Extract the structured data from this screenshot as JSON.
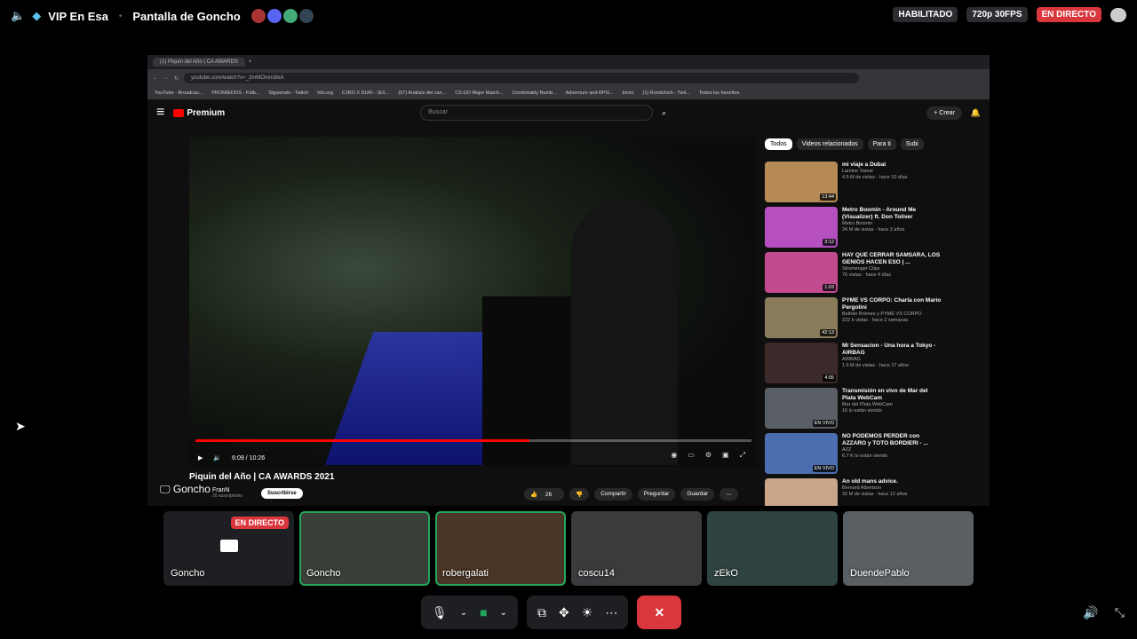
{
  "topbar": {
    "server_name": "VIP En Esa",
    "stream_title": "Pantalla de Goncho",
    "status_habilitado": "HABILITADO",
    "quality": "720p 30FPS",
    "live_label": "EN DIRECTO",
    "colors": {
      "live": "#da373c",
      "speaking": "#23a55a"
    }
  },
  "browser": {
    "tab_title": "(1) Piquín del Año | CA AWARDS",
    "url": "youtube.com/watch?v=_2mMOmm3lxA",
    "bookmarks": [
      "YouTube - Broadcas...",
      "PROMIEDOS - Fútb...",
      "Siguiendo - Twitch",
      "hltv.org",
      "CJRO X DUKI - (EX...",
      "(57) Análisis del can...",
      "CS:GO Major Match...",
      "Comfortably Numb...",
      "Adventure and RPG...",
      "Inicio",
      "(1) Rondchich - Twit...",
      "Todos los favoritos"
    ]
  },
  "youtube": {
    "logo": "Premium",
    "search_placeholder": "Buscar",
    "create_label": "Crear",
    "time": "6:09 / 10:26",
    "progress_fraction": 0.6,
    "video_title": "Piquin del Año | CA AWARDS 2021",
    "channel_name": "FranN",
    "channel_subs": "20 suscriptores",
    "subscribe_label": "Suscribirse",
    "likes": "26",
    "share_label": "Compartir",
    "ask_label": "Preguntar",
    "save_label": "Guardar",
    "chips": [
      "Todos",
      "Videos relacionados",
      "Para ti",
      "Subi"
    ],
    "recs": [
      {
        "title": "mi viaje a Dubai",
        "channel": "Lamine Yamal",
        "meta": "4.5 M de vistas · hace 10 días",
        "duration": "13:44",
        "color": "#b58a55"
      },
      {
        "title": "Metro Boomin - Around Me (Visualizer) ft. Don Toliver",
        "channel": "Metro Boomin",
        "meta": "34 M de vistas · hace 3 años",
        "duration": "3:12",
        "color": "#b64fc0"
      },
      {
        "title": "HAY QUE CERRAR SAMSARA, LOS GENIOS HACEN ESO | ...",
        "channel": "Stromenger Clips",
        "meta": "76 vistas · hace 4 días",
        "duration": "1:03",
        "color": "#c24a8f"
      },
      {
        "title": "PYME VS CORPO: Charla con Mario Pergolini",
        "channel": "Beltrán Briones y PYME VS CORPO",
        "meta": "222 k vistas · hace 2 semanas",
        "duration": "42:13",
        "color": "#8a7c5a"
      },
      {
        "title": "Mi Sensacion - Una hora a Tokyo - AIRBAG",
        "channel": "AIRBAG",
        "meta": "1.6 M de vistas · hace 17 años",
        "duration": "4:05",
        "color": "#3c2a2a"
      },
      {
        "title": "Transmisión en vivo de Mar del Plata WebCam",
        "channel": "Mar del Plata WebCam",
        "meta": "16 lo están viendo",
        "duration": "EN VIVO",
        "color": "#5a5f66"
      },
      {
        "title": "NO PODEMOS PERDER con AZZARO y TOTO BORDIERI - ...",
        "channel": "AZZ",
        "meta": "6.7 K lo están viendo",
        "duration": "EN VIVO",
        "color": "#4c6db0"
      },
      {
        "title": "An old mans advice.",
        "channel": "Bernard Albertson",
        "meta": "32 M de vistas · hace 12 años",
        "duration": "",
        "color": "#c9a58a"
      }
    ]
  },
  "overlay_name": "Goncho",
  "participants": [
    {
      "name": "Goncho",
      "live": "EN DIRECTO",
      "color": "#1e1f22"
    },
    {
      "name": "Goncho",
      "color": "#3a3f38"
    },
    {
      "name": "robergalati",
      "color": "#4a3526"
    },
    {
      "name": "coscu14",
      "color": "#3b3b3e"
    },
    {
      "name": "zEkO",
      "color": "#2f4340"
    },
    {
      "name": "DuendePablo",
      "color": "#5a5f63"
    }
  ]
}
